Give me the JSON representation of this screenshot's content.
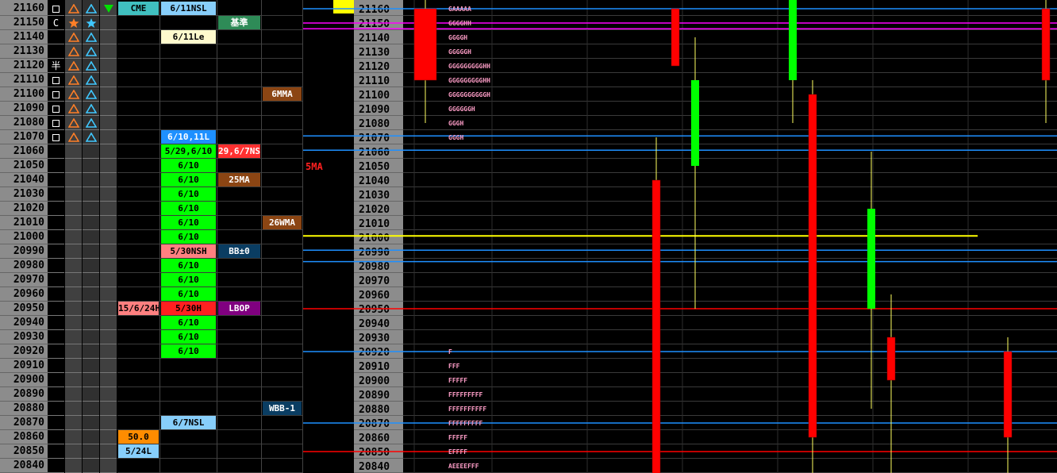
{
  "prices": [
    21160,
    21150,
    21140,
    21130,
    21120,
    21110,
    21100,
    21090,
    21080,
    21070,
    21060,
    21050,
    21040,
    21030,
    21020,
    21010,
    21000,
    20990,
    20980,
    20970,
    20960,
    20950,
    20940,
    20930,
    20920,
    20910,
    20900,
    20890,
    20880,
    20870,
    20860,
    20850,
    20840
  ],
  "icon_rows": [
    [
      "square",
      "triangle-orange",
      "triangle-blue"
    ],
    [
      "C",
      "star-orange",
      "star-blue"
    ],
    [
      "",
      "triangle-orange",
      "triangle-blue"
    ],
    [
      "",
      "triangle-orange",
      "triangle-blue"
    ],
    [
      "半",
      "triangle-orange",
      "triangle-blue"
    ],
    [
      "square",
      "triangle-orange",
      "triangle-blue"
    ],
    [
      "square",
      "triangle-orange",
      "triangle-blue"
    ],
    [
      "square",
      "triangle-orange",
      "triangle-blue"
    ],
    [
      "square",
      "triangle-orange",
      "triangle-blue"
    ],
    [
      "square",
      "triangle-orange",
      "triangle-blue"
    ]
  ],
  "marker_icon": "down-triangle-green",
  "labels": [
    {
      "text": "CME",
      "row": 0,
      "col": 0,
      "bg": "#40c0c0",
      "fg": "#000"
    },
    {
      "text": "6/11NSL",
      "row": 0,
      "col": 1,
      "bg": "#87cefa",
      "fg": "#000"
    },
    {
      "text": "基準",
      "row": 1,
      "col": 2,
      "bg": "#2e8b57",
      "fg": "#fff"
    },
    {
      "text": "6/11Le",
      "row": 2,
      "col": 1,
      "bg": "#fffacd",
      "fg": "#000"
    },
    {
      "text": "6MMA",
      "row": 6,
      "col": 3,
      "bg": "#8b4513",
      "fg": "#fff"
    },
    {
      "text": "6/10,11L",
      "row": 9,
      "col": 1,
      "bg": "#1e90ff",
      "fg": "#fff"
    },
    {
      "text": "5/29,6/10",
      "row": 10,
      "col": 1,
      "bg": "#00ff00",
      "fg": "#000"
    },
    {
      "text": "29,6/7NSH",
      "row": 10,
      "col": 2,
      "bg": "#ff3030",
      "fg": "#fff"
    },
    {
      "text": "25MA",
      "row": 12,
      "col": 2,
      "bg": "#8b4513",
      "fg": "#fff"
    },
    {
      "text": "26WMA",
      "row": 15,
      "col": 3,
      "bg": "#8b4513",
      "fg": "#fff"
    },
    {
      "text": "5/30NSH",
      "row": 17,
      "col": 1,
      "bg": "#ff8080",
      "fg": "#000"
    },
    {
      "text": "BB±0",
      "row": 17,
      "col": 2,
      "bg": "#0a3d62",
      "fg": "#fff"
    },
    {
      "text": "15/6/24H",
      "row": 21,
      "col": 0,
      "bg": "#ff8080",
      "fg": "#000"
    },
    {
      "text": "5/30H",
      "row": 21,
      "col": 1,
      "bg": "#ff2020",
      "fg": "#000"
    },
    {
      "text": "LBOP",
      "row": 21,
      "col": 2,
      "bg": "#800080",
      "fg": "#fff"
    },
    {
      "text": "WBB-1",
      "row": 28,
      "col": 3,
      "bg": "#0a3d62",
      "fg": "#fff"
    },
    {
      "text": "6/7NSL",
      "row": 29,
      "col": 1,
      "bg": "#87cefa",
      "fg": "#000"
    },
    {
      "text": "50.0",
      "row": 30,
      "col": 0,
      "bg": "#ff8c00",
      "fg": "#000"
    },
    {
      "text": "5/24L",
      "row": 31,
      "col": 0,
      "bg": "#87cefa",
      "fg": "#000"
    }
  ],
  "green_rows": {
    "text": "6/10",
    "rows": [
      11,
      12,
      13,
      14,
      15,
      16,
      18,
      19,
      20,
      22,
      23,
      24
    ]
  },
  "ma_label": "5MA",
  "chart_data": {
    "type": "candlestick",
    "yaxis_ticks": [
      21160,
      21150,
      21140,
      21130,
      21120,
      21110,
      21100,
      21090,
      21080,
      21070,
      21060,
      21050,
      21040,
      21030,
      21020,
      21010,
      21000,
      20990,
      20980,
      20970,
      20960,
      20950,
      20940,
      20930,
      20920,
      20910,
      20900,
      20890,
      20880,
      20870,
      20860,
      20850,
      20840
    ],
    "hlines": [
      {
        "price": 21160,
        "color": "#1e90ff"
      },
      {
        "price": 21150,
        "color": "#ff00ff"
      },
      {
        "price": 21146,
        "color": "#ff00ff"
      },
      {
        "price": 21071,
        "color": "#1e90ff"
      },
      {
        "price": 21061,
        "color": "#1e90ff"
      },
      {
        "price": 21001,
        "color": "#ffff00"
      },
      {
        "price": 20991,
        "color": "#1e90ff"
      },
      {
        "price": 20983,
        "color": "#1e90ff"
      },
      {
        "price": 20950,
        "color": "#ff0000"
      },
      {
        "price": 20920,
        "color": "#1e90ff"
      },
      {
        "price": 20870,
        "color": "#1e90ff"
      },
      {
        "price": 20850,
        "color": "#ff0000"
      }
    ],
    "profile": [
      {
        "price": 21160,
        "text": "GAAAAA"
      },
      {
        "price": 21150,
        "text": "GGGGHH"
      },
      {
        "price": 21140,
        "text": "GGGGH"
      },
      {
        "price": 21130,
        "text": "GGGGGH"
      },
      {
        "price": 21120,
        "text": "GGGGGGGGGHH"
      },
      {
        "price": 21110,
        "text": "GGGGGGGGGHH"
      },
      {
        "price": 21100,
        "text": "GGGGGGGGGGH"
      },
      {
        "price": 21090,
        "text": "GGGGGGH"
      },
      {
        "price": 21080,
        "text": "GGGH"
      },
      {
        "price": 21070,
        "text": "GGGH"
      },
      {
        "price": 20920,
        "text": "F"
      },
      {
        "price": 20910,
        "text": "FFF"
      },
      {
        "price": 20900,
        "text": "FFFFF"
      },
      {
        "price": 20890,
        "text": "FFFFFFFFF"
      },
      {
        "price": 20880,
        "text": "FFFFFFFFFF"
      },
      {
        "price": 20870,
        "text": "FFFFFFFFF"
      },
      {
        "price": 20860,
        "text": "FFFFF"
      },
      {
        "price": 20850,
        "text": "EFFFF"
      },
      {
        "price": 20840,
        "text": "AEEEEFFF"
      }
    ],
    "candles": [
      {
        "open": 21160,
        "close": 21110,
        "high": 21170,
        "low": 21080,
        "color": "red"
      },
      {
        "open": 21160,
        "close": 21120,
        "high": 21160,
        "low": 21120,
        "color": "red"
      },
      {
        "open": 21050,
        "close": 21110,
        "high": 21140,
        "low": 20950,
        "color": "green"
      },
      {
        "open": 21110,
        "close": 21180,
        "high": 21180,
        "low": 21080,
        "color": "green"
      },
      {
        "open": 21040,
        "close": 20830,
        "high": 21070,
        "low": 20830,
        "color": "red"
      },
      {
        "open": 21100,
        "close": 20860,
        "high": 21110,
        "low": 20830,
        "color": "red"
      },
      {
        "open": 20950,
        "close": 21020,
        "high": 21060,
        "low": 20880,
        "color": "green"
      },
      {
        "open": 20930,
        "close": 20900,
        "high": 20960,
        "low": 20830,
        "color": "red"
      },
      {
        "open": 20920,
        "close": 20860,
        "high": 20930,
        "low": 20830,
        "color": "red"
      },
      {
        "open": 21160,
        "close": 21110,
        "high": 21170,
        "low": 21080,
        "color": "red"
      }
    ]
  }
}
